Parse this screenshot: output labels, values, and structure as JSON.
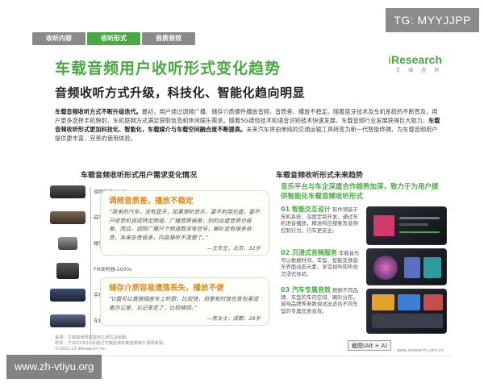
{
  "watermarks": {
    "top_right": "TG: MYYJJPP",
    "bottom_left": "www.zh-vtiyu.org"
  },
  "tabs": [
    {
      "label": "收听内容",
      "active": false
    },
    {
      "label": "收听形式",
      "active": true
    },
    {
      "label": "音质音效",
      "active": false
    }
  ],
  "title": "车载音频用户收听形式变化趋势",
  "subtitle": "音频收听方式升级，科技化、智能化趋向明显",
  "logo": {
    "main": "Research",
    "prefix": "i",
    "sub": "艾 瑞 咨 询"
  },
  "body": {
    "lead1": "车载音频收听方式不断升级迭代。",
    "text1": "最初，用户通过调频广播、储存介质硬件播放音频，音质差、播放不稳定。随着蓝牙技术及车机系统的不断普及，用户更多选择手机映射、车机联网方式满足获取信息和休闲娱乐需求。随着5G通信技术和语音识别技术快速发展，车载音频行业发展获得巨大助力，",
    "lead2": "车载音频收听形式更加科技化、智能化，车载媒介与车载空间融合度不断提高。",
    "text2": "未来汽车将由单纯的交通运输工具转变为新一代智能终端，为车载音频用户提供更丰富、完善的使用体验。"
  },
  "left_section": {
    "title": "车载音频收听形式用户需求变化情况",
    "timeline": [
      {
        "label": "调频广播-1950s"
      },
      {
        "label": "磁带卡盒-1990s"
      },
      {
        "label": "硬件U盘-2000s"
      },
      {
        "label": "FM发射器-2000s"
      },
      {
        "label": "手机映射-2010s"
      },
      {
        "label": "车机联网-2020s"
      }
    ],
    "quotes": [
      {
        "heading": "调频音质差，播放不稳定",
        "text": "“原来的汽车，没有蓝牙，如果想听音乐，要不利用光盘，要不只收音机调成特定频道，广播音质很差，别的出盘音质也很差。而且，调频广播只个频道数没有信号，嘛叭会有很多杂音，本来杂音很多，内容是听不清楚了。”",
        "by": "—王先生，北京，32岁"
      },
      {
        "heading": "储存介质容易遗落丢失，播放不便",
        "text": "“U盘可以直接插座车上听歌，比较快，但是有时放在背包里或者办公室，忘记拿走了，比较麻烦。”",
        "by": "—陈女士，成都，28岁"
      }
    ]
  },
  "right_section": {
    "title": "车载音频收听形式未来趋势",
    "heading": "音乐平台与车企深度合作趋势加深，致力于为用户提供智能化车载音频收听形式",
    "items": [
      {
        "num": "01 智能交互设计",
        "text": "软件预装于车机系统，深度定制开发，通过车机语音播放，精准响应搜索及音频控制行为，行车更安全。"
      },
      {
        "num": "02 沉浸式音频服务",
        "text": "车载音乐可以根据时间、车型、智能变换音乐界面动态元素，享受视听和听觉沉浸式体验。"
      },
      {
        "num": "03 汽车专属音效",
        "text": "根据不同品牌、车型的车内空间、喇叭分布，音响品牌等参数调试出适合不同车型的专属优质音效。"
      }
    ],
    "tooltip": "截图(Alt + A)"
  },
  "footer": {
    "source": "来源：艾瑞咨询研究院自主研究及绘制。",
    "note": "样本：于2022年10月通过艾瑞咨询车载音频用户调研获得。",
    "copyright": "©2022.11 iResearch Inc.",
    "url": "www.iresearch.com.cn"
  }
}
